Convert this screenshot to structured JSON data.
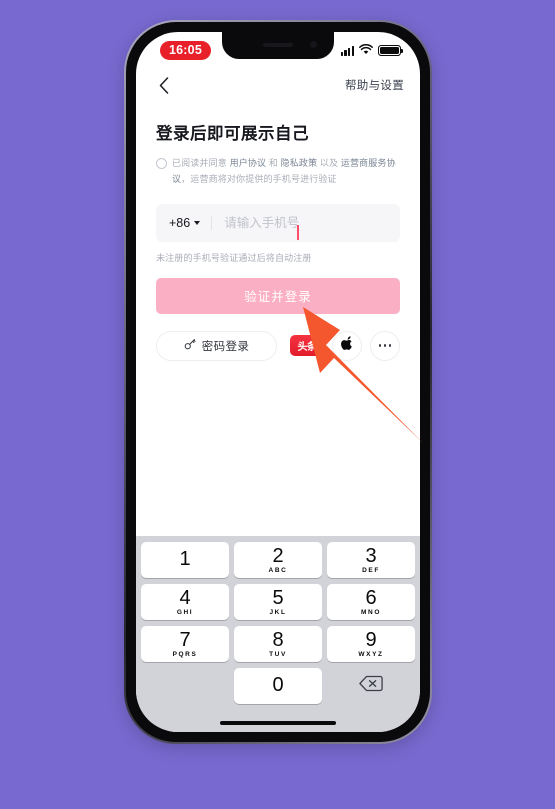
{
  "page": {
    "background_color": "#7769cf",
    "device": "iPhone mockup"
  },
  "status_bar": {
    "time": "16:05",
    "time_badge_color": "#e8202a",
    "signal_icon": "cellular-signal-icon",
    "wifi_icon": "wifi-icon",
    "battery_icon": "battery-full-icon"
  },
  "nav_bar": {
    "back_icon": "chevron-left-icon",
    "help_settings_label": "帮助与设置"
  },
  "login": {
    "title": "登录后即可展示自己",
    "agreement": {
      "checkbox_state": "unchecked",
      "prefix": "已阅读并同意 ",
      "link1": "用户协议",
      "sep1": " 和 ",
      "link2": "隐私政策",
      "sep2": " 以及 ",
      "link3": "运营商服务协议",
      "suffix": "，运营商将对你提供的手机号进行验证"
    },
    "phone_field": {
      "country_code": "+86",
      "caret_icon": "chevron-down-icon",
      "placeholder": "请输入手机号",
      "value": "",
      "cursor_color": "#ff4d6a"
    },
    "register_hint": "未注册的手机号验证通过后将自动注册",
    "primary_button": {
      "label": "验证并登录",
      "background": "#fbafc4",
      "text_color": "#ffffff"
    },
    "options": {
      "password_login_label": "密码登录",
      "password_login_icon": "key-icon",
      "toutiao_label": "头条",
      "toutiao_icon": "toutiao-logo-icon",
      "toutiao_color": "#e11b2b",
      "apple_icon": "apple-logo-icon",
      "more_icon": "more-horizontal-icon"
    }
  },
  "keyboard": {
    "type": "numeric-keypad",
    "keys": [
      {
        "num": "1",
        "letters": ""
      },
      {
        "num": "2",
        "letters": "ABC"
      },
      {
        "num": "3",
        "letters": "DEF"
      },
      {
        "num": "4",
        "letters": "GHI"
      },
      {
        "num": "5",
        "letters": "JKL"
      },
      {
        "num": "6",
        "letters": "MNO"
      },
      {
        "num": "7",
        "letters": "PQRS"
      },
      {
        "num": "8",
        "letters": "TUV"
      },
      {
        "num": "9",
        "letters": "WXYZ"
      },
      {
        "num": "0",
        "letters": ""
      }
    ],
    "delete_icon": "backspace-icon",
    "background": "#d2d3d9"
  },
  "annotation": {
    "arrow_color": "#f4572e",
    "points_at": "toutiao-login-button"
  }
}
